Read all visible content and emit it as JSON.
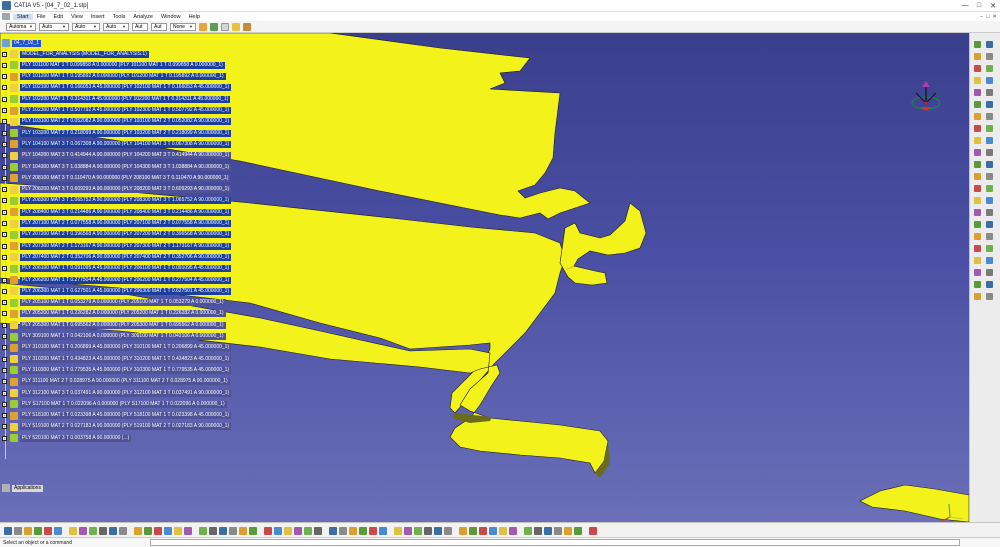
{
  "window": {
    "title": "CATIA V5 - [04_7_02_1.stp]",
    "controls": [
      "—",
      "□",
      "✕"
    ]
  },
  "menu": {
    "items": [
      "Start",
      "File",
      "Edit",
      "View",
      "Insert",
      "Tools",
      "Analyze",
      "Window",
      "Help"
    ],
    "active": "Start",
    "right_controls": [
      "–",
      "□",
      "✕"
    ]
  },
  "toolbar": {
    "combos": [
      {
        "name": "color",
        "value": "Automa"
      },
      {
        "name": "linetype",
        "value": "Auto"
      },
      {
        "name": "linewidth",
        "value": "Auto"
      },
      {
        "name": "layer",
        "value": "Auto"
      },
      {
        "name": "pattern",
        "value": "Aut"
      },
      {
        "name": "fill",
        "value": "Aut"
      },
      {
        "name": "lineweight",
        "value": "None"
      }
    ]
  },
  "tree": {
    "root": "04_7_02_1",
    "nodes": [
      {
        "label": "MODEL_FOR_ANALYSIS (MODEL_FOR_ANALYSIS.1)",
        "selected": true
      },
      {
        "label": "PLY 101100 MAT 1 T 0.099858 A 0.000000 (PLY 101100 MAT 1 T 0.099858 A 0.000000_1)",
        "selected": true
      },
      {
        "label": "PLY 101200 MAT 1 T 0.195892 A 0.000000 (PLY 101200 MAT 1 T 0.195892 A 0.000000_1)",
        "selected": true
      },
      {
        "label": "PLY 102100 MAT 1 T 0.166053 A 45.000000 (PLY 102100 MAT 1 T 0.166053 A 45.000000_1)",
        "selected": true
      },
      {
        "label": "PLY 102200 MAT 1 T 0.314311 A 45.000000 (PLY 102200 MAT 1 T 0.314311 A 45.000000_1)",
        "selected": true
      },
      {
        "label": "PLY 102300 MAT 1 T 0.507792 A 45.000000 (PLY 102300 MAT 1 T 0.507792 A 45.000000_1)",
        "selected": true
      },
      {
        "label": "PLY 103100 MAT 2 T 0.052082 A 90.000000 (PLY 103100 MAT 2 T 0.052082 A 90.000000_1)",
        "selected": true
      },
      {
        "label": "PLY 103200 MAT 2 T 0.218099 A 90.000000 (PLY 103200 MAT 2 T 0.218099 A 90.000000_1)",
        "selected": true
      },
      {
        "label": "PLY 104100 MAT 3 T 0.067308 A 90.000000 (PLY 104100 MAT 3 T 0.067308 A 90.000000_1)",
        "selected": true
      },
      {
        "label": "PLY 104200 MAT 3 T 0.414944 A 90.000000 (PLY 104200 MAT 3 T 0.414944 A 90.000000_1)",
        "selected": false
      },
      {
        "label": "PLY 104300 MAT 3 T 1.038884 A 90.000000 (PLY 104300 MAT 3 T 1.038884 A 90.000000_1)",
        "selected": false
      },
      {
        "label": "PLY 208100 MAT 3 T 0.110470 A 90.000000 (PLY 208100 MAT 3 T 0.110470 A 90.000000_1)",
        "selected": false
      },
      {
        "label": "PLY 208200 MAT 3 T 0.609293 A 90.000000 (PLY 208200 MAT 3 T 0.609293 A 90.000000_1)",
        "selected": false
      },
      {
        "label": "PLY 208300 MAT 3 T 1.065752 A 90.000000 (PLY 208300 MAT 3 T 1.065752 A 90.000000_1)",
        "selected": true
      },
      {
        "label": "PLY 208400 MAT 3 T 0.214486 A 90.000000 (PLY 208400 MAT 3 T 0.214486 A 90.000000_1)",
        "selected": true
      },
      {
        "label": "PLY 207100 MAT 2 T 0.077558 A 90.000000 (PLY 207100 MAT 2 T 0.077558 A 90.000000_1)",
        "selected": true
      },
      {
        "label": "PLY 207200 MAT 2 T 0.396568 A 90.000000 (PLY 207200 MAT 2 T 0.396568 A 90.000000_1)",
        "selected": true
      },
      {
        "label": "PLY 207300 MAT 2 T 1.173167 A 90.000000 (PLY 207300 MAT 2 T 1.173167 A 90.000000_1)",
        "selected": true
      },
      {
        "label": "PLY 207400 MAT 2 T 0.352706 A 90.000000 (PLY 207400 MAT 2 T 0.352706 A 90.000000_1)",
        "selected": true
      },
      {
        "label": "PLY 206100 MAT 1 T 0.091095 A 45.000000 (PLY 206100 MAT 1 T 0.091095 A 45.000000_1)",
        "selected": true
      },
      {
        "label": "PLY 206200 MAT 1 T 0.277504 A 45.000000 (PLY 206200 MAT 1 T 0.277504 A 45.000000_1)",
        "selected": true
      },
      {
        "label": "PLY 206300 MAT 1 T 0.627501 A 45.000000 (PLY 206300 MAT 1 T 0.627501 A 45.000000_1)",
        "selected": true
      },
      {
        "label": "PLY 205100 MAT 1 T 0.053279 A 0.000000 (PLY 205100 MAT 1 T 0.053279 A 0.000000_1)",
        "selected": false
      },
      {
        "label": "PLY 205200 MAT 1 T 0.226282 A 0.000000 (PLY 205200 MAT 1 T 0.226282 A 0.000000_1)",
        "selected": false
      },
      {
        "label": "PLY 205300 MAT 1 T 0.695562 A 0.000000 (PLY 205300 MAT 1 T 0.695562 A 0.000000_1)",
        "selected": false
      },
      {
        "label": "PLY 309100 MAT 1 T 0.042106 A 0.000000 (PLY 309100 MAT 1 T 0.042106 A 0.000000_1)",
        "selected": false
      },
      {
        "label": "PLY 310100 MAT 1 T 0.206899 A 45.000000 (PLY 310100 MAT 1 T 0.206899 A 45.000000_1)",
        "selected": false
      },
      {
        "label": "PLY 310200 MAT 1 T 0.434823 A 45.000000 (PLY 310200 MAT 1 T 0.434823 A 45.000000_1)",
        "selected": false
      },
      {
        "label": "PLY 310300 MAT 1 T 0.779535 A 45.000000 (PLY 310300 MAT 1 T 0.779535 A 45.000000_1)",
        "selected": false
      },
      {
        "label": "PLY 311100 MAT 2 T 0.028975 A 90.000000 (PLY 311100 MAT 2 T 0.028975 A 90.000000_1)",
        "selected": false
      },
      {
        "label": "PLY 312100 MAT 3 T 0.037491 A 90.000000 (PLY 312100 MAT 3 T 0.037491 A 90.000000_1)",
        "selected": false
      },
      {
        "label": "PLY S17100 MAT 1 T 0.022096 A 0.000000 (PLY S17100 MAT 1 T 0.022096 A 0.000000_1)",
        "selected": false
      },
      {
        "label": "PLY 518100 MAT 1 T 0.023398 A 45.000000 (PLY 518100 MAT 1 T 0.023398 A 45.000000_1)",
        "selected": false
      },
      {
        "label": "PLY 519100 MAT 2 T 0.027183 A 90.000000 (PLY 519100 MAT 2 T 0.027183 A 90.000000_1)",
        "selected": false
      },
      {
        "label": "PLY 520100 MAT 3 T 0.003758 A 90.000000 (...)",
        "selected": false
      }
    ],
    "applications": "Applications"
  },
  "viewport": {
    "background_top": "#3a3f8c",
    "background_bottom": "#6a6fb8",
    "part_color": "#f3f21a",
    "part_edge": "#1a1a1a"
  },
  "status": {
    "message": "Select an object or a command"
  },
  "colors": {
    "selection": "#1c3f9c",
    "tree_unselected": "#4e5296"
  }
}
